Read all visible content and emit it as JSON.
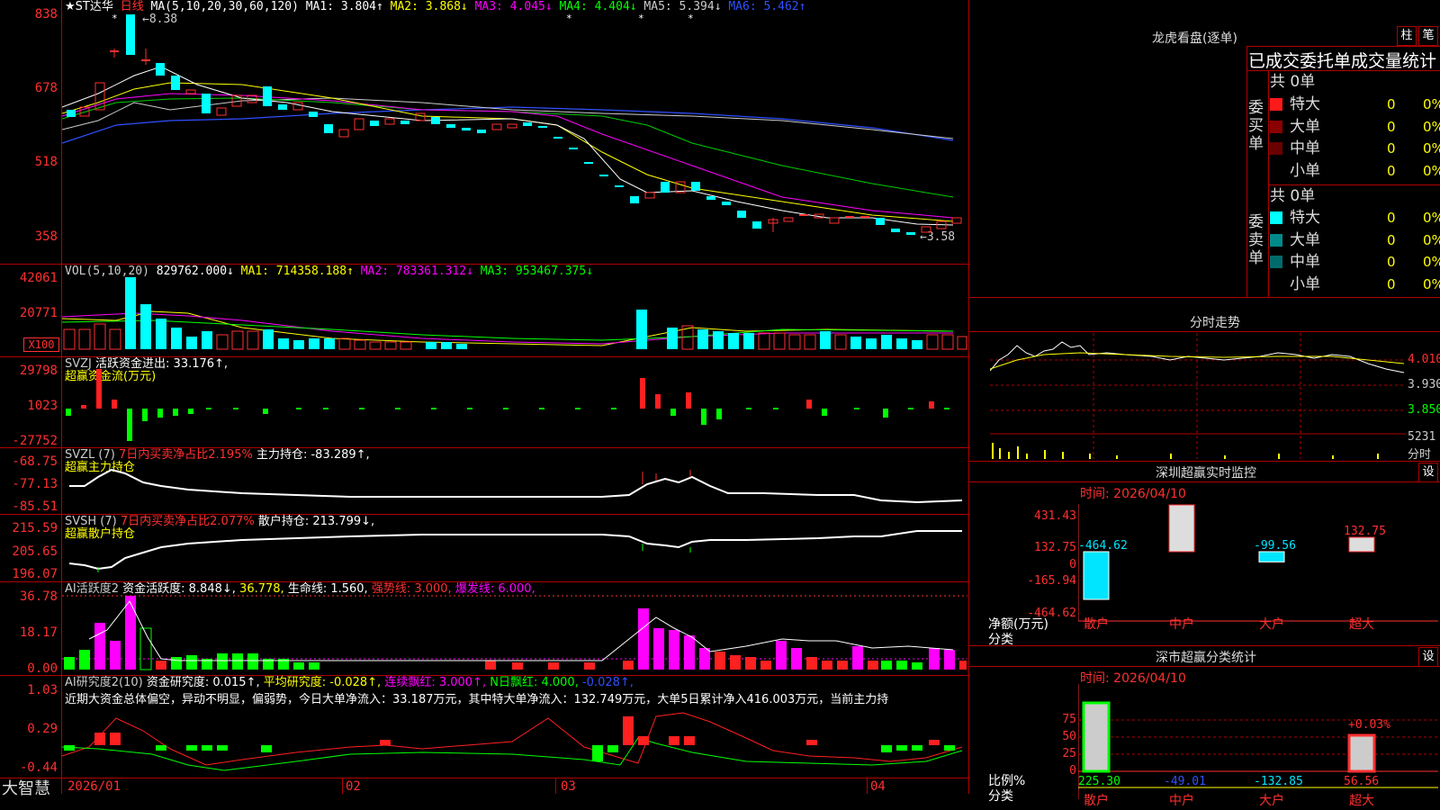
{
  "main_chart": {
    "title": "★ST达华",
    "period": "日线",
    "ma_label": "MA(5,10,20,30,60,120)",
    "ma1": "MA1: 3.804↑",
    "ma2": "MA2: 3.868↓",
    "ma3": "MA3: 4.045↓",
    "ma4": "MA4: 4.404↓",
    "ma5": "MA5: 5.394↓",
    "ma6": "MA6: 5.462↑",
    "ticks": [
      "838",
      "678",
      "518",
      "358"
    ],
    "high_label": "8.38",
    "low_label": "3.58"
  },
  "vol_panel": {
    "label": "VOL(5,10,20)",
    "value": "829762.000↓",
    "ma1": "MA1: 714358.188↑",
    "ma2": "MA2: 783361.312↓",
    "ma3": "MA3: 953467.375↓",
    "ticks": [
      "42061",
      "20771"
    ],
    "unit": "X100"
  },
  "svzj_panel": {
    "label": "SVZJ",
    "text": "活跃资金进出: 33.176↑,",
    "subtitle": "超赢资金流(万元)",
    "ticks": [
      "29798",
      "1023",
      "-27752"
    ]
  },
  "svzl_panel": {
    "label": "SVZL (7)",
    "ratio": "7日内买卖净占比2.195%",
    "hold": "主力持仓: -83.289↑,",
    "subtitle": "超赢主力持仓",
    "ticks": [
      "-68.75",
      "-77.13",
      "-85.51"
    ]
  },
  "svsh_panel": {
    "label": "SVSH (7)",
    "ratio": "7日内买卖净占比2.077%",
    "hold": "散户持仓: 213.799↓,",
    "subtitle": "超赢散户持仓",
    "ticks": [
      "215.59",
      "205.65",
      "196.07"
    ]
  },
  "ai_active_panel": {
    "label": "AI活跃度2",
    "v1": "资金活跃度: 8.848↓,",
    "v2": "36.778,",
    "v3": "生命线: 1.560,",
    "v4": "强势线: 3.000,",
    "v5": "爆发线: 6.000,",
    "ticks": [
      "36.78",
      "18.17",
      "0.00"
    ]
  },
  "ai_research_panel": {
    "label": "AI研究度2(10)",
    "v1": "资金研究度: 0.015↑,",
    "v2": "平均研究度: -0.028↑,",
    "v3": "连续飘红: 3.000↑,",
    "v4": "N日飘红: 4.000,",
    "v5": "-0.028↑,",
    "summary": "近期大资金总体偏空，异动不明显，偏弱势，今日大单净流入：33.187万元，其中特大单净流入：132.749万元，大单5日累计净入416.003万元，当前主力持",
    "ticks": [
      "1.03",
      "0.29",
      "-0.44"
    ]
  },
  "x_axis": {
    "brand": "大智慧",
    "labels": [
      "2026/01",
      "02",
      "03",
      "04"
    ]
  },
  "lhb": {
    "title": "龙虎看盘(逐单)",
    "btn_col": "柱",
    "btn_pen": "笔",
    "header": "已成交委托单成交量统计",
    "buy_side": "委买单",
    "sell_side": "委卖单",
    "buy_total": "共 0单",
    "sell_total": "共 0单",
    "buy_rows": [
      {
        "name": "特大",
        "val": "0",
        "pct": "0%",
        "color": "#ff1a1a"
      },
      {
        "name": "大单",
        "val": "0",
        "pct": "0%",
        "color": "#8b0000"
      },
      {
        "name": "中单",
        "val": "0",
        "pct": "0%",
        "color": "#6b0000"
      },
      {
        "name": "小单",
        "val": "0",
        "pct": "0%",
        "color": ""
      }
    ],
    "sell_rows": [
      {
        "name": "特大",
        "val": "0",
        "pct": "0%",
        "color": "#00ffff"
      },
      {
        "name": "大单",
        "val": "0",
        "pct": "0%",
        "color": "#008b8b"
      },
      {
        "name": "中单",
        "val": "0",
        "pct": "0%",
        "color": "#006b6b"
      },
      {
        "name": "小单",
        "val": "0",
        "pct": "0%",
        "color": ""
      }
    ]
  },
  "intraday": {
    "title": "分时走势",
    "ticks": [
      "4.010",
      "3.930",
      "3.850"
    ],
    "vol_label": "5231",
    "unit": "分时"
  },
  "sz_monitor": {
    "title": "深圳超赢实时监控",
    "btn": "设",
    "time": "时间: 2026/04/10",
    "ticks": [
      "431.43",
      "132.75",
      "0",
      "-165.94",
      "-464.62"
    ],
    "y_title": "净额(万元)",
    "x_title": "分类",
    "categories": [
      "散户",
      "中户",
      "大户",
      "超大"
    ],
    "values": [
      -464.62,
      431.43,
      -99.56,
      132.75
    ],
    "value_labels": [
      "-464.62",
      "431.43",
      "-99.56",
      "132.75"
    ]
  },
  "sz_class": {
    "title": "深市超赢分类统计",
    "btn": "设",
    "time": "时间: 2026/04/10",
    "ticks": [
      "75",
      "50",
      "25",
      "0"
    ],
    "y_title": "比例%",
    "x_title": "分类",
    "categories": [
      "散户",
      "中户",
      "大户",
      "超大"
    ],
    "values": [
      225.3,
      -49.01,
      -132.85,
      56.56
    ],
    "value_labels": [
      "225.30",
      "-49.01",
      "-132.85",
      "56.56"
    ],
    "extra_label": "+0.03%"
  },
  "chart_data": {
    "type": "bar",
    "title": "深圳超赢实时监控",
    "categories": [
      "散户",
      "中户",
      "大户",
      "超大"
    ],
    "values": [
      -464.62,
      431.43,
      -99.56,
      132.75
    ],
    "ylabel": "净额(万元)",
    "ylim": [
      -464.62,
      431.43
    ]
  }
}
